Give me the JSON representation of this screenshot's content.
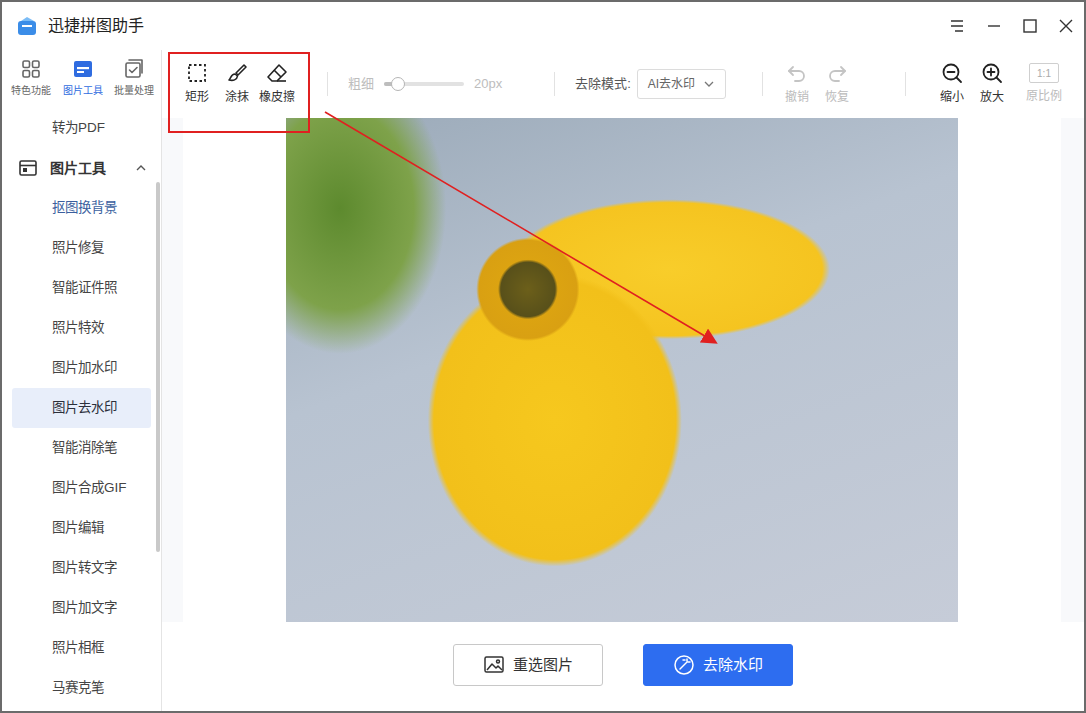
{
  "window": {
    "title": "迅捷拼图助手"
  },
  "nav_tabs": [
    {
      "label": "特色功能",
      "selected": false
    },
    {
      "label": "图片工具",
      "selected": true
    },
    {
      "label": "批量处理",
      "selected": false
    }
  ],
  "sidebar": {
    "items_above": [
      {
        "label": "转为PDF"
      }
    ],
    "section": {
      "label": "图片工具",
      "expanded": true
    },
    "items": [
      {
        "label": "抠图换背景",
        "selected": false,
        "highlighted": true
      },
      {
        "label": "照片修复",
        "selected": false,
        "highlighted": false
      },
      {
        "label": "智能证件照",
        "selected": false,
        "highlighted": false
      },
      {
        "label": "照片特效",
        "selected": false,
        "highlighted": false
      },
      {
        "label": "图片加水印",
        "selected": false,
        "highlighted": false
      },
      {
        "label": "图片去水印",
        "selected": true,
        "highlighted": false
      },
      {
        "label": "智能消除笔",
        "selected": false,
        "highlighted": false
      },
      {
        "label": "图片合成GIF",
        "selected": false,
        "highlighted": false
      },
      {
        "label": "图片编辑",
        "selected": false,
        "highlighted": false
      },
      {
        "label": "图片转文字",
        "selected": false,
        "highlighted": false
      },
      {
        "label": "图片加文字",
        "selected": false,
        "highlighted": false
      },
      {
        "label": "照片相框",
        "selected": false,
        "highlighted": false
      },
      {
        "label": "马赛克笔",
        "selected": false,
        "highlighted": false
      }
    ]
  },
  "toolbar": {
    "tools": [
      {
        "label": "矩形"
      },
      {
        "label": "涂抹"
      },
      {
        "label": "橡皮擦"
      }
    ],
    "thickness": {
      "label": "粗细",
      "reading": "20px",
      "level": 0.17,
      "disabled": true
    },
    "mode": {
      "label": "去除模式:",
      "value": "AI去水印"
    },
    "history": [
      {
        "label": "撤销",
        "disabled": true
      },
      {
        "label": "恢复",
        "disabled": true
      }
    ],
    "zoom": [
      {
        "label": "缩小",
        "disabled": false
      },
      {
        "label": "放大",
        "disabled": false
      },
      {
        "label": "原比例",
        "badge": "1:1",
        "disabled": true
      }
    ]
  },
  "buttons": [
    {
      "label": "重选图片",
      "kind": "secondary"
    },
    {
      "label": "去除水印",
      "kind": "primary"
    }
  ]
}
